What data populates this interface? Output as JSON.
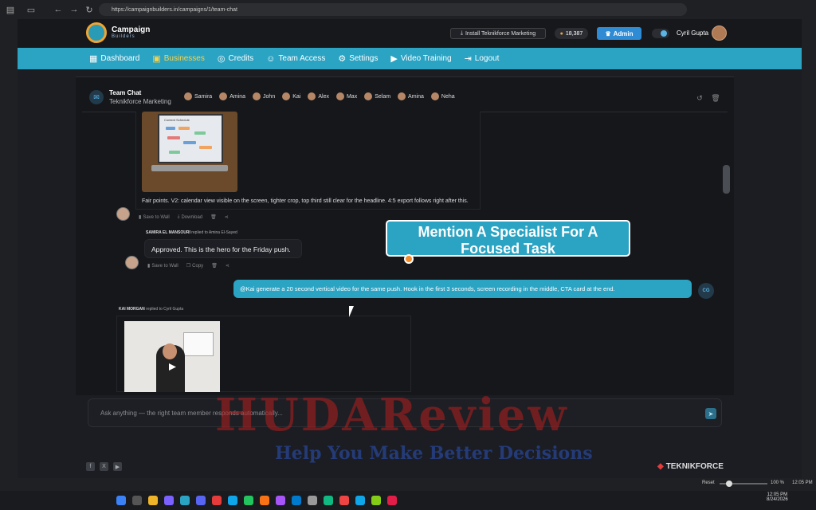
{
  "browser": {
    "url": "https://campaignbuilders.in/campaigns/1/team-chat"
  },
  "header": {
    "logo_title": "Campaign",
    "logo_subtitle": "Builders",
    "install_label": "Install Teknikforce Marketing",
    "credits": "18,387",
    "admin_label": "Admin",
    "user_name": "Cyril Gupta"
  },
  "nav": {
    "items": [
      {
        "label": "Dashboard",
        "icon": "grid-icon"
      },
      {
        "label": "Businesses",
        "icon": "briefcase-icon"
      },
      {
        "label": "Credits",
        "icon": "coins-icon"
      },
      {
        "label": "Team Access",
        "icon": "users-icon"
      },
      {
        "label": "Settings",
        "icon": "gear-icon"
      },
      {
        "label": "Video Training",
        "icon": "video-icon"
      },
      {
        "label": "Logout",
        "icon": "logout-icon"
      }
    ],
    "active_index": 1
  },
  "chat": {
    "title": "Team Chat",
    "subtitle": "Teknikforce Marketing",
    "members": [
      "Samira",
      "Amina",
      "John",
      "Kai",
      "Alex",
      "Max",
      "Selam",
      "Amina",
      "Neha"
    ],
    "messages": {
      "image_title": "Content Schedule",
      "caption": "Fair points. V2: calendar view visible on the screen, tighter crop, top third still clear for the headline. 4:5 export follows right after this.",
      "actions1": {
        "save": "Save to Wall",
        "download": "Download"
      },
      "reply_sender": "SAMIRA EL MANSOURI",
      "reply_to": "replied to Amina El-Sayed",
      "reply_text": "Approved. This is the hero for the Friday push.",
      "actions2": {
        "save": "Save to Wall",
        "copy": "Copy"
      },
      "user_text": "@Kai generate a 20 second vertical video for the same push. Hook in the first 3 seconds, screen recording in the middle, CTA card at the end.",
      "user_initials": "CG",
      "kai_sender": "KAI MORGAN",
      "kai_reply_to": "replied to Cyril Gupta"
    },
    "composer_placeholder": "Ask anything — the right team member responds automatically..."
  },
  "overlay": {
    "callout_text": "Mention A Specialist For A Focused Task",
    "watermark_main": "HUDAReview",
    "watermark_tag": "Help You Make Better Decisions"
  },
  "footer": {
    "brand": "TEKNIKFORCE"
  },
  "statusbar": {
    "reset": "Reset",
    "zoom": "100 %",
    "time": "12:05 PM",
    "tray_time": "12:05 PM",
    "tray_date": "8/24/2026"
  },
  "colors": {
    "accent": "#2ba3c3",
    "active_nav": "#f7d24b",
    "admin": "#2f8bd4",
    "callout_dot": "#f28b2a"
  }
}
